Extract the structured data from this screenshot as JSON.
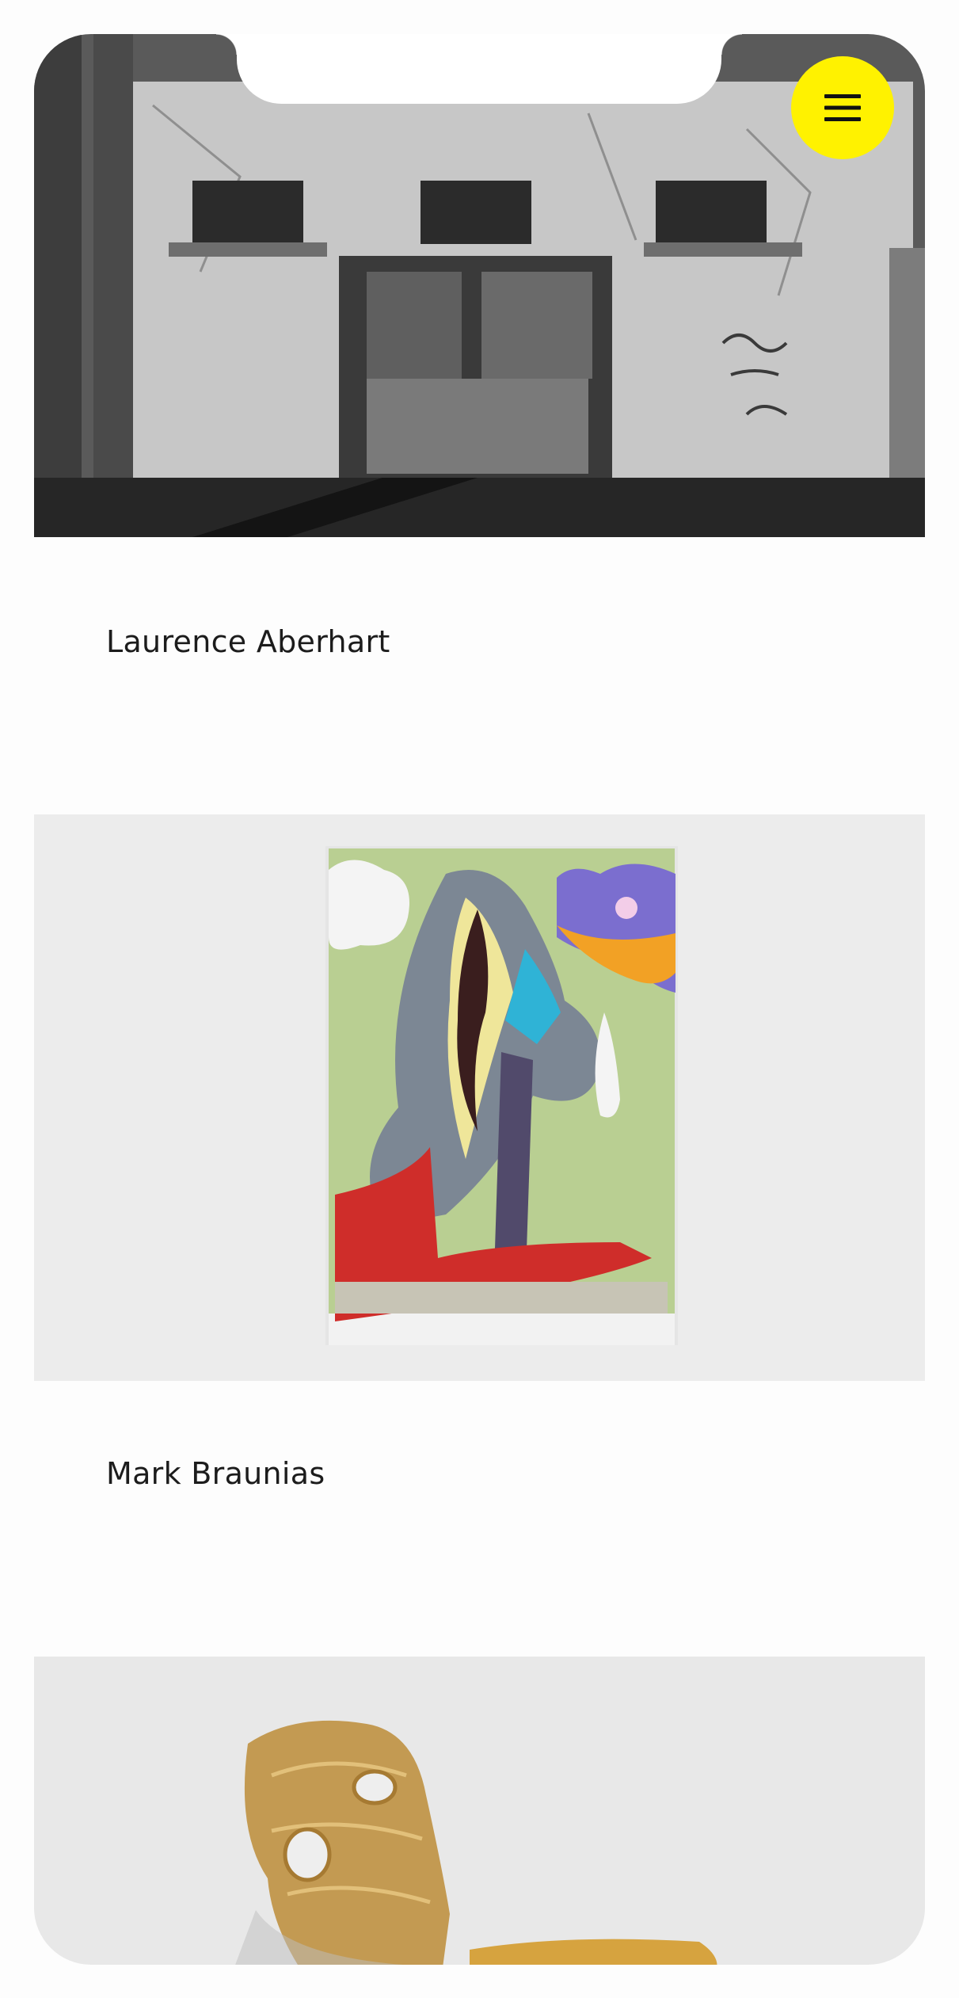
{
  "nav": {
    "menu_icon": "hamburger-icon",
    "accent_color": "#fff200"
  },
  "artists": [
    {
      "name": "Laurence Aberhart",
      "image": "black-and-white photograph of a weathered building facade with graffiti"
    },
    {
      "name": "Mark Braunias",
      "image": "colourful abstract quilted textile artwork hung on a white wall"
    },
    {
      "name": "",
      "image": "amber resin sculpture with cut-out holes on a white wall"
    }
  ]
}
